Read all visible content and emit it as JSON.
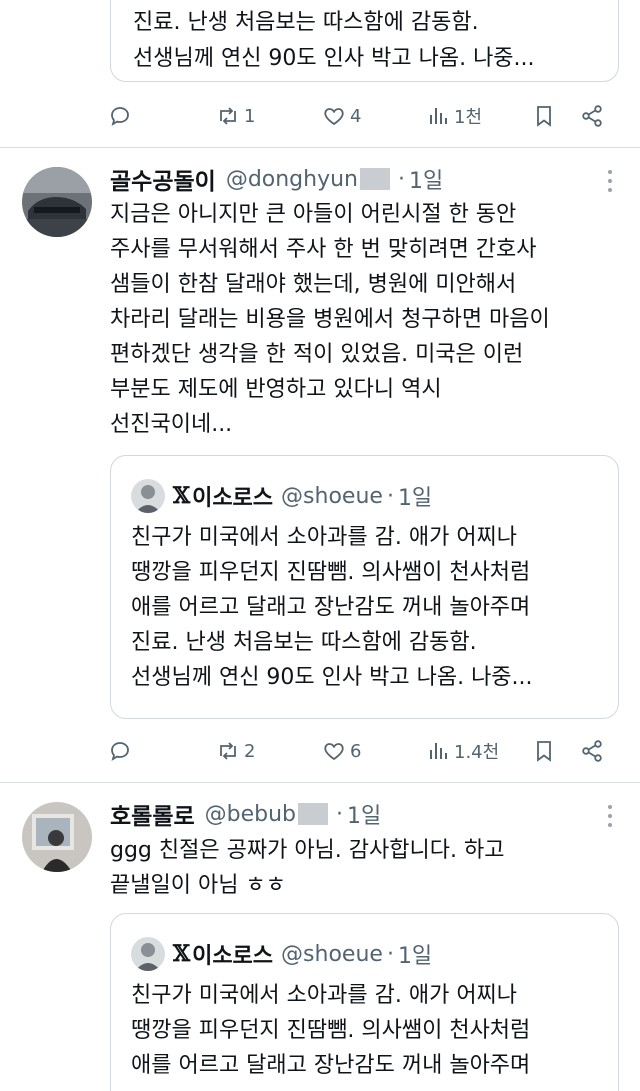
{
  "top_quote": {
    "lines": [
      "진료. 난생 처음보는 따스함에 감동함.",
      "선생님께 연신 90도 인사 박고 나옴. 나중..."
    ]
  },
  "top_actions": {
    "reply": "",
    "retweet": "1",
    "like": "4",
    "views": "1천"
  },
  "tweets": [
    {
      "name": "골수공돌이",
      "handle": "@donghyun",
      "dot": "·",
      "time": "1일",
      "body": [
        "지금은 아니지만 큰 아들이 어린시절 한 동안",
        "주사를 무서워해서 주사 한 번 맞히려면 간호사",
        "샘들이 한참 달래야 했는데, 병원에 미안해서",
        "차라리 달래는 비용을 병원에서 청구하면 마음이",
        "편하겠단 생각을 한 적이 있었음. 미국은 이런",
        "부분도 제도에 반영하고 있다니 역시",
        "선진국이네..."
      ],
      "quote": {
        "x": "𝕏",
        "name": "이소로스",
        "handle": "@shoeue",
        "dot": "·",
        "time": "1일",
        "lines": [
          "친구가 미국에서 소아과를 감. 애가 어찌나",
          "땡깡을 피우던지 진땀뺌. 의사쌤이 천사처럼",
          "애를 어르고 달래고 장난감도 꺼내 놀아주며",
          "진료. 난생 처음보는 따스함에 감동함.",
          "선생님께 연신 90도 인사 박고 나옴. 나중..."
        ]
      },
      "actions": {
        "reply": "",
        "retweet": "2",
        "like": "6",
        "views": "1.4천"
      }
    },
    {
      "name": "호롤롤로",
      "handle": "@bebub",
      "dot": "·",
      "time": "1일",
      "body": [
        "ggg 친절은 공짜가 아님. 감사합니다. 하고",
        "끝낼일이 아님 ㅎㅎ"
      ],
      "quote": {
        "x": "𝕏",
        "name": "이소로스",
        "handle": "@shoeue",
        "dot": "·",
        "time": "1일",
        "lines": [
          "친구가 미국에서 소아과를 감. 애가 어찌나",
          "땡깡을 피우던지 진땀뺌. 의사쌤이 천사처럼",
          "애를 어르고 달래고 장난감도 꺼내 놀아주며"
        ]
      }
    }
  ],
  "icons": [
    "reply-icon",
    "retweet-icon",
    "like-icon",
    "views-icon",
    "bookmark-icon",
    "share-icon",
    "more-icon"
  ],
  "colors": {
    "text": "#0f1419",
    "secondary": "#536471",
    "border": "#cfd9de"
  }
}
